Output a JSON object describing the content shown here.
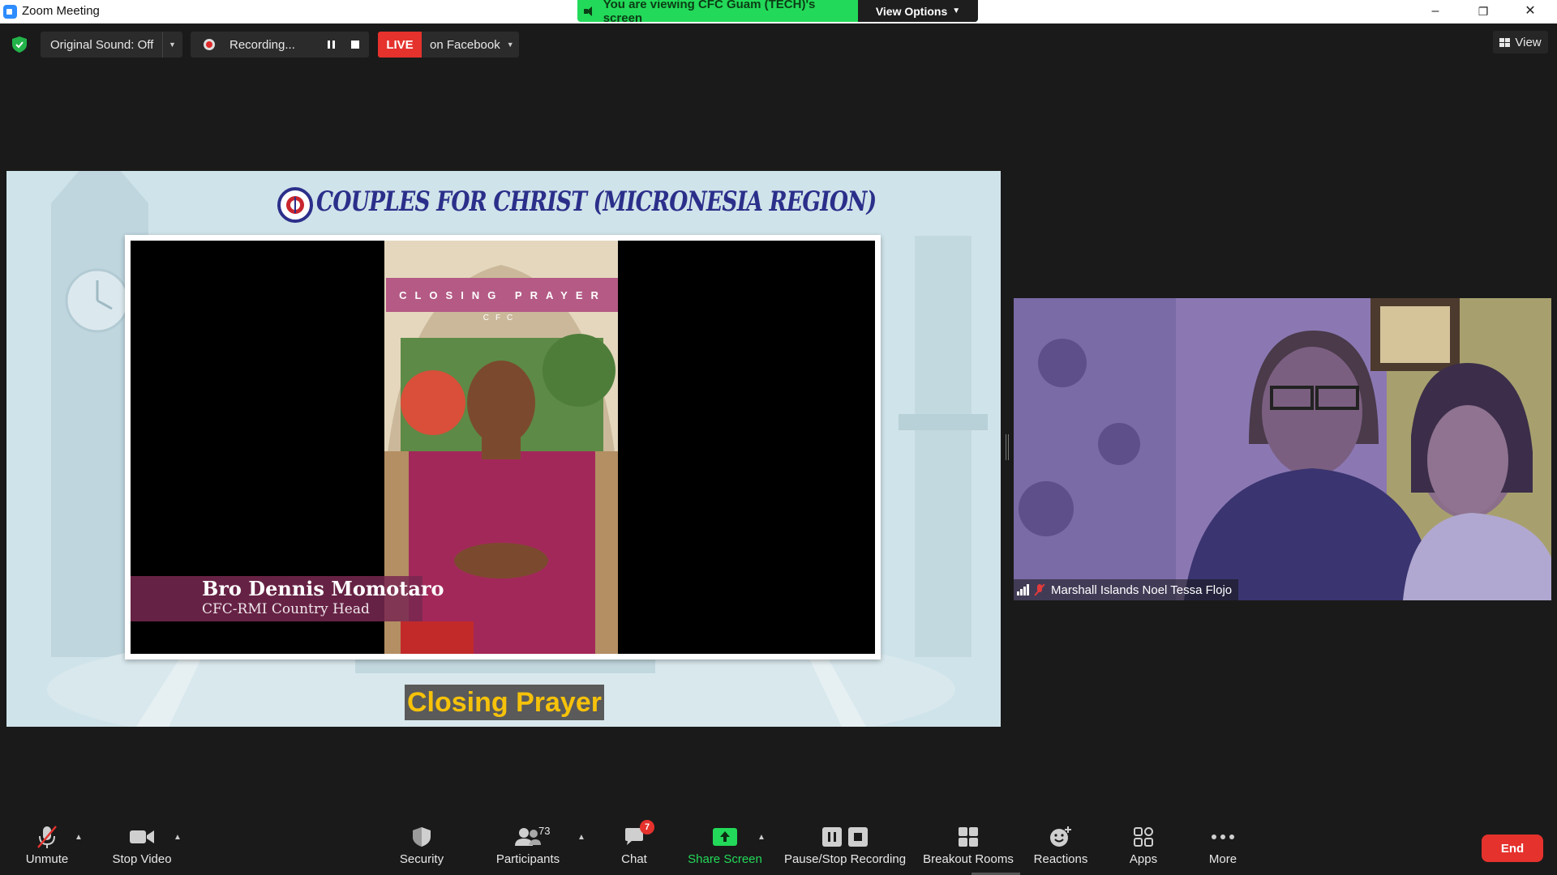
{
  "window": {
    "title": "Zoom Meeting",
    "viewing_banner": "You are viewing CFC Guam (TECH)'s screen",
    "view_options_label": "View Options",
    "minimize": "–",
    "restore": "❐",
    "close": "✕"
  },
  "top_toolbar": {
    "original_sound": "Original Sound: Off",
    "recording_label": "Recording...",
    "live_label": "LIVE",
    "live_destination": "on Facebook",
    "view_label": "View"
  },
  "shared_content": {
    "org_title": "COUPLES FOR CHRIST (MICRONESIA REGION)",
    "banner_title": "CLOSING PRAYER",
    "banner_sub": "CFC",
    "speaker_name": "Bro Dennis Momotaro",
    "speaker_role": "CFC-RMI Country Head",
    "caption": "Closing Prayer"
  },
  "participant": {
    "name": "Marshall Islands Noel Tessa Flojo"
  },
  "bottom_toolbar": {
    "unmute": "Unmute",
    "stop_video": "Stop Video",
    "security": "Security",
    "participants": "Participants",
    "participants_count": "73",
    "chat": "Chat",
    "chat_badge": "7",
    "share_screen": "Share Screen",
    "pause_stop_recording": "Pause/Stop Recording",
    "breakout_rooms": "Breakout Rooms",
    "reactions": "Reactions",
    "apps": "Apps",
    "more": "More",
    "end": "End"
  },
  "colors": {
    "share_green": "#23d959",
    "live_red": "#e5322d",
    "background": "#1a1a1a",
    "org_blue": "#2b2f8a",
    "caption_yellow": "#f6c20a"
  }
}
